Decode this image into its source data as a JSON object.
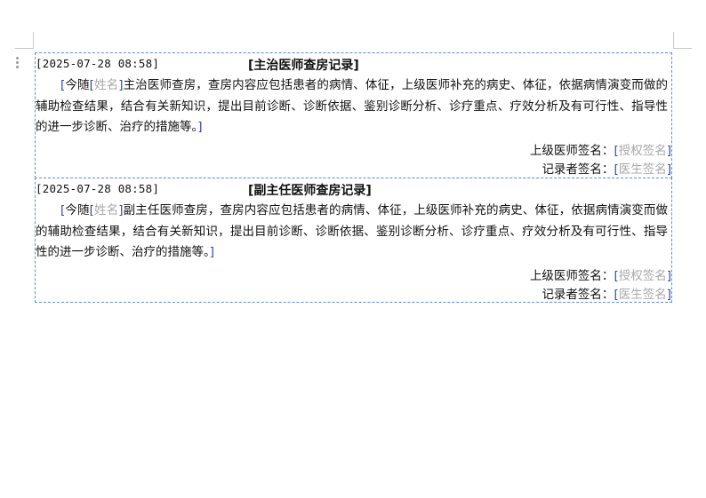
{
  "records": [
    {
      "time": "[2025-07-28 08:58]",
      "title_prefix": "[",
      "title": "主治医师查房记录",
      "title_suffix": "]",
      "body_open": "[",
      "body_lead": "今随",
      "name_open": "[",
      "name_placeholder": "姓名",
      "name_close": "]",
      "body_text": "主治医师查房，查房内容应包括患者的病情、体征，上级医师补充的病史、体征，依据病情演变而做的辅助检查结果，结合有关新知识，提出目前诊断、诊断依据、鉴别诊断分析、诊疗重点、疗效分析及有可行性、指导性的进一步诊断、治疗的措施等。",
      "body_close": "]",
      "sig1_label": "上级医师签名：",
      "sig1_open": "[",
      "sig1_placeholder": "授权签名",
      "sig1_close": "]",
      "sig2_label": "记录者签名：",
      "sig2_open": "[",
      "sig2_placeholder": "医生签名",
      "sig2_close": "]"
    },
    {
      "time": "[2025-07-28 08:58]",
      "title_prefix": "[",
      "title": "副主任医师查房记录",
      "title_suffix": "]",
      "body_open": "[",
      "body_lead": "今随",
      "name_open": "[",
      "name_placeholder": "姓名",
      "name_close": "]",
      "body_text": "副主任医师查房，查房内容应包括患者的病情、体征，上级医师补充的病史、体征，依据病情演变而做的辅助检查结果，结合有关新知识，提出目前诊断、诊断依据、鉴别诊断分析、诊疗重点、疗效分析及有可行性、指导性的进一步诊断、治疗的措施等。",
      "body_close": "]",
      "sig1_label": "上级医师签名：",
      "sig1_open": "[",
      "sig1_placeholder": "授权签名",
      "sig1_close": "]",
      "sig2_label": "记录者签名：",
      "sig2_open": "[",
      "sig2_placeholder": "医生签名",
      "sig2_close": "]"
    }
  ]
}
